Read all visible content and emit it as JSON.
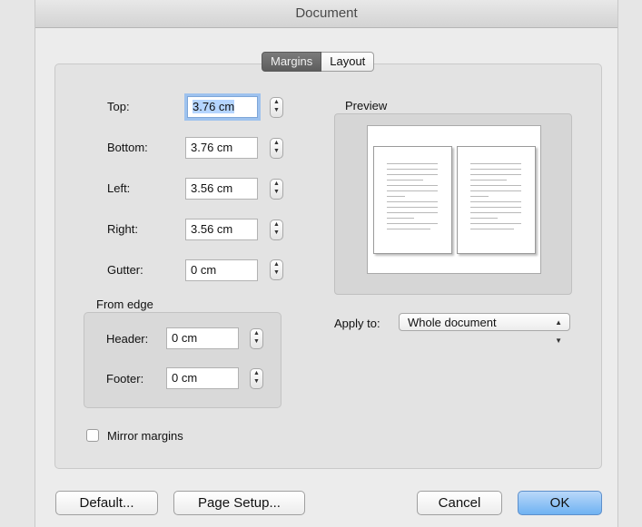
{
  "window": {
    "title": "Document"
  },
  "tabs": [
    {
      "label": "Margins",
      "selected": true
    },
    {
      "label": "Layout",
      "selected": false
    }
  ],
  "margins": [
    {
      "label": "Top:",
      "value": "3.76 cm",
      "focused": true
    },
    {
      "label": "Bottom:",
      "value": "3.76 cm",
      "focused": false
    },
    {
      "label": "Left:",
      "value": "3.56 cm",
      "focused": false
    },
    {
      "label": "Right:",
      "value": "3.56 cm",
      "focused": false
    },
    {
      "label": "Gutter:",
      "value": "0 cm",
      "focused": false
    }
  ],
  "from_edge": {
    "title": "From edge",
    "header": {
      "label": "Header:",
      "value": "0 cm"
    },
    "footer": {
      "label": "Footer:",
      "value": "0 cm"
    }
  },
  "preview": {
    "title": "Preview"
  },
  "apply_to": {
    "label": "Apply to:",
    "value": "Whole document"
  },
  "mirror_margins": {
    "label": "Mirror margins",
    "checked": false
  },
  "buttons": {
    "default": "Default...",
    "page_setup": "Page Setup...",
    "cancel": "Cancel",
    "ok": "OK"
  },
  "colors": {
    "accent": "#6fb2f2",
    "focus_ring": "#9ec2ee",
    "tab_selected": "#6b6b6b"
  }
}
